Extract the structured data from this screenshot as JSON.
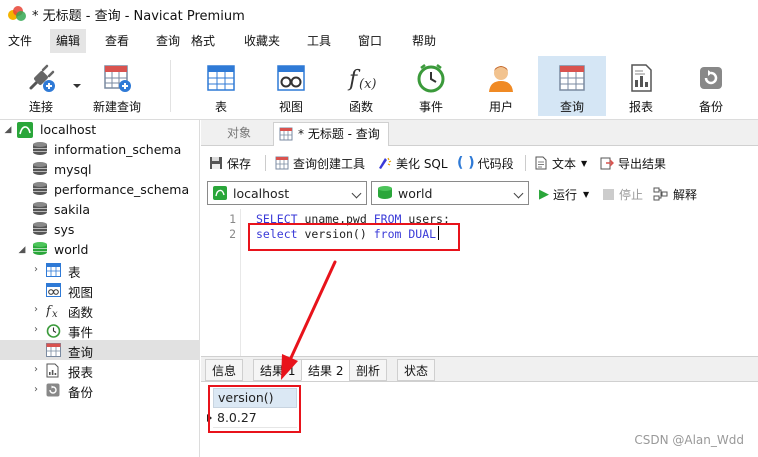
{
  "window": {
    "title": "* 无标题 - 查询 - Navicat Premium"
  },
  "menu": {
    "items": [
      "文件",
      "编辑",
      "查看",
      "查询",
      "格式",
      "收藏夹",
      "工具",
      "窗口",
      "帮助"
    ],
    "active": "编辑"
  },
  "toolbar": {
    "buttons": [
      {
        "label": "连接",
        "icon": "plug-icon"
      },
      {
        "label": "新建查询",
        "icon": "new-query-icon"
      },
      {
        "label": "表",
        "icon": "table-icon"
      },
      {
        "label": "视图",
        "icon": "view-icon"
      },
      {
        "label": "函数",
        "icon": "function-icon"
      },
      {
        "label": "事件",
        "icon": "clock-icon"
      },
      {
        "label": "用户",
        "icon": "user-icon"
      },
      {
        "label": "查询",
        "icon": "query-icon"
      },
      {
        "label": "报表",
        "icon": "report-icon"
      },
      {
        "label": "备份",
        "icon": "backup-icon"
      }
    ],
    "selected": "查询"
  },
  "sidebar": {
    "connection": "localhost",
    "databases": [
      "information_schema",
      "mysql",
      "performance_schema",
      "sakila",
      "sys",
      "world"
    ],
    "world_children": [
      {
        "label": "表",
        "icon": "table-icon"
      },
      {
        "label": "视图",
        "icon": "view-icon"
      },
      {
        "label": "函数",
        "icon": "function-icon"
      },
      {
        "label": "事件",
        "icon": "clock-icon"
      },
      {
        "label": "查询",
        "icon": "query-icon"
      },
      {
        "label": "报表",
        "icon": "report-icon"
      },
      {
        "label": "备份",
        "icon": "backup-icon"
      }
    ]
  },
  "tabs": {
    "objects": "对象",
    "query": "* 无标题 - 查询"
  },
  "editor_toolbar": {
    "save": "保存",
    "query_builder": "查询创建工具",
    "beautify": "美化 SQL",
    "snippet": "代码段",
    "text": "文本",
    "export": "导出结果"
  },
  "connbar": {
    "connection": "localhost",
    "database": "world",
    "run": "运行",
    "stop": "停止",
    "explain": "解释"
  },
  "editor": {
    "lines": [
      {
        "no": "1",
        "tokens": [
          {
            "t": "SELECT",
            "kw": true
          },
          {
            "t": " uname,pwd ",
            "kw": false
          },
          {
            "t": "FROM",
            "kw": true
          },
          {
            "t": " users;",
            "kw": false
          }
        ]
      },
      {
        "no": "2",
        "tokens": [
          {
            "t": "select",
            "kw": true
          },
          {
            "t": " version() ",
            "kw": false
          },
          {
            "t": "from",
            "kw": true
          },
          {
            "t": " ",
            "kw": false
          },
          {
            "t": "DUAL",
            "kw": true
          }
        ]
      }
    ]
  },
  "result_tabs": [
    "信息",
    "结果 1",
    "结果 2",
    "剖析",
    "状态"
  ],
  "result_active": "结果 2",
  "results": {
    "column": "version()",
    "value": "8.0.27"
  },
  "watermark": "CSDN @Alan_Wdd",
  "colors": {
    "accent_red": "#e8131b",
    "selected_blue": "#d5e6f5",
    "keyword_blue": "#3a3ad8",
    "db_green": "#2aa63a"
  }
}
